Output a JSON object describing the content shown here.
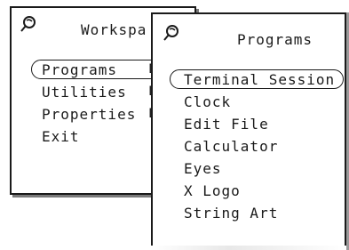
{
  "workspace_menu": {
    "title": "Workspa",
    "pin_icon": "pushpin-icon",
    "items": [
      {
        "label": "Programs",
        "submenu_marker": "D",
        "default": true
      },
      {
        "label": "Utilities",
        "submenu_marker": "D",
        "default": false
      },
      {
        "label": "Properties",
        "submenu_marker": "D",
        "default": false
      },
      {
        "label": "Exit",
        "submenu_marker": "",
        "default": false
      }
    ]
  },
  "programs_menu": {
    "title": "Programs",
    "pin_icon": "pushpin-icon",
    "items": [
      {
        "label": "Terminal Session",
        "default": true
      },
      {
        "label": "Clock",
        "default": false
      },
      {
        "label": "Edit File",
        "default": false
      },
      {
        "label": "Calculator",
        "default": false
      },
      {
        "label": "Eyes",
        "default": false
      },
      {
        "label": "X Logo",
        "default": false
      },
      {
        "label": "String Art",
        "default": false
      }
    ]
  },
  "colors": {
    "background": "#ffffff",
    "foreground": "#1a1a1a",
    "shadow": "#7a7a7a"
  }
}
